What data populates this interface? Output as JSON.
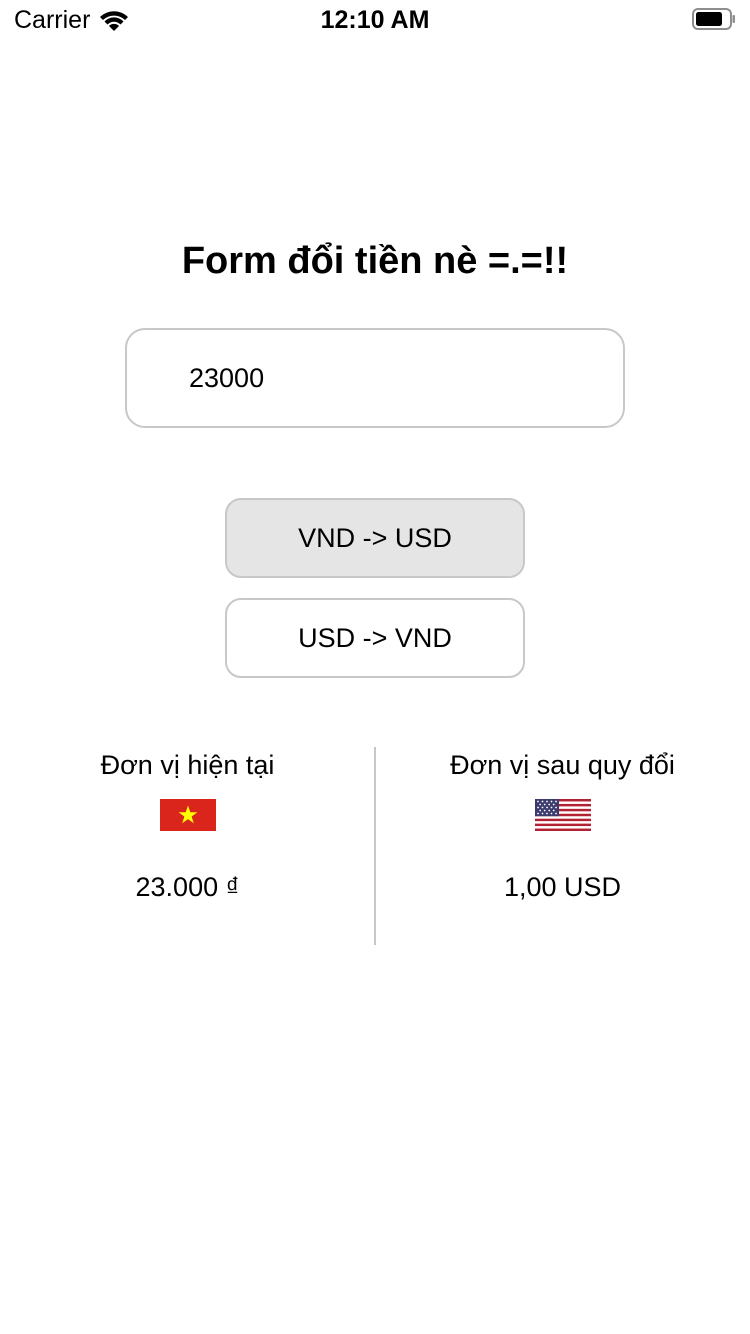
{
  "status_bar": {
    "carrier": "Carrier",
    "time": "12:10 AM"
  },
  "form": {
    "title": "Form đổi tiền nè =.=!!",
    "amount_value": "23000",
    "buttons": {
      "vnd_to_usd": "VND -> USD",
      "usd_to_vnd": "USD -> VND"
    }
  },
  "result": {
    "current_unit_label": "Đơn vị hiện tại",
    "current_value": "23.000 ₫",
    "converted_unit_label": "Đơn vị sau quy đổi",
    "converted_value": "1,00 USD"
  },
  "icons": {
    "left_flag": "vietnam-flag-icon",
    "right_flag": "us-flag-icon"
  },
  "colors": {
    "border": "#c8c8c8",
    "selected_button_bg": "#e5e5e5",
    "vn_flag_red": "#da251d",
    "vn_flag_star": "#ffff00",
    "us_flag_blue": "#3c3b6e",
    "us_flag_red": "#b22234"
  }
}
